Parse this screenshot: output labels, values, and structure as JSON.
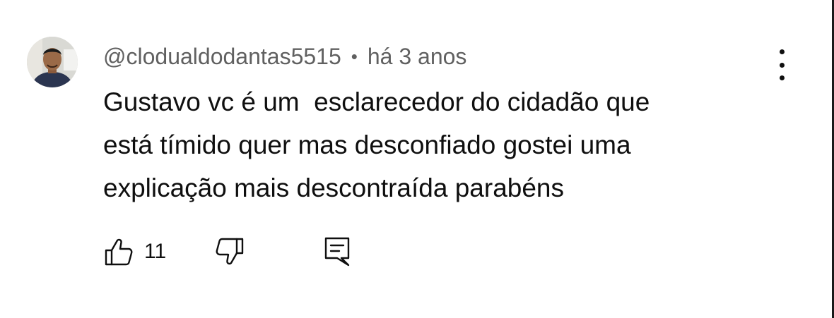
{
  "comment": {
    "author_handle": "@clodualdodantas5515",
    "separator": "•",
    "posted_time": "há 3 anos",
    "text": "Gustavo vc é um  esclarecedor do cidadão que\nestá tímido quer mas desconfiado gostei uma\nexplicação mais descontraída parabéns",
    "like_count": "11"
  },
  "icons": {
    "avatar": "user-avatar-photo",
    "menu": "more-vertical-icon",
    "like": "thumbs-up-icon",
    "dislike": "thumbs-down-icon",
    "reply": "reply-comment-icon"
  },
  "colors": {
    "background": "#ffffff",
    "text_primary": "#0f0f0f",
    "text_secondary": "#606060"
  }
}
